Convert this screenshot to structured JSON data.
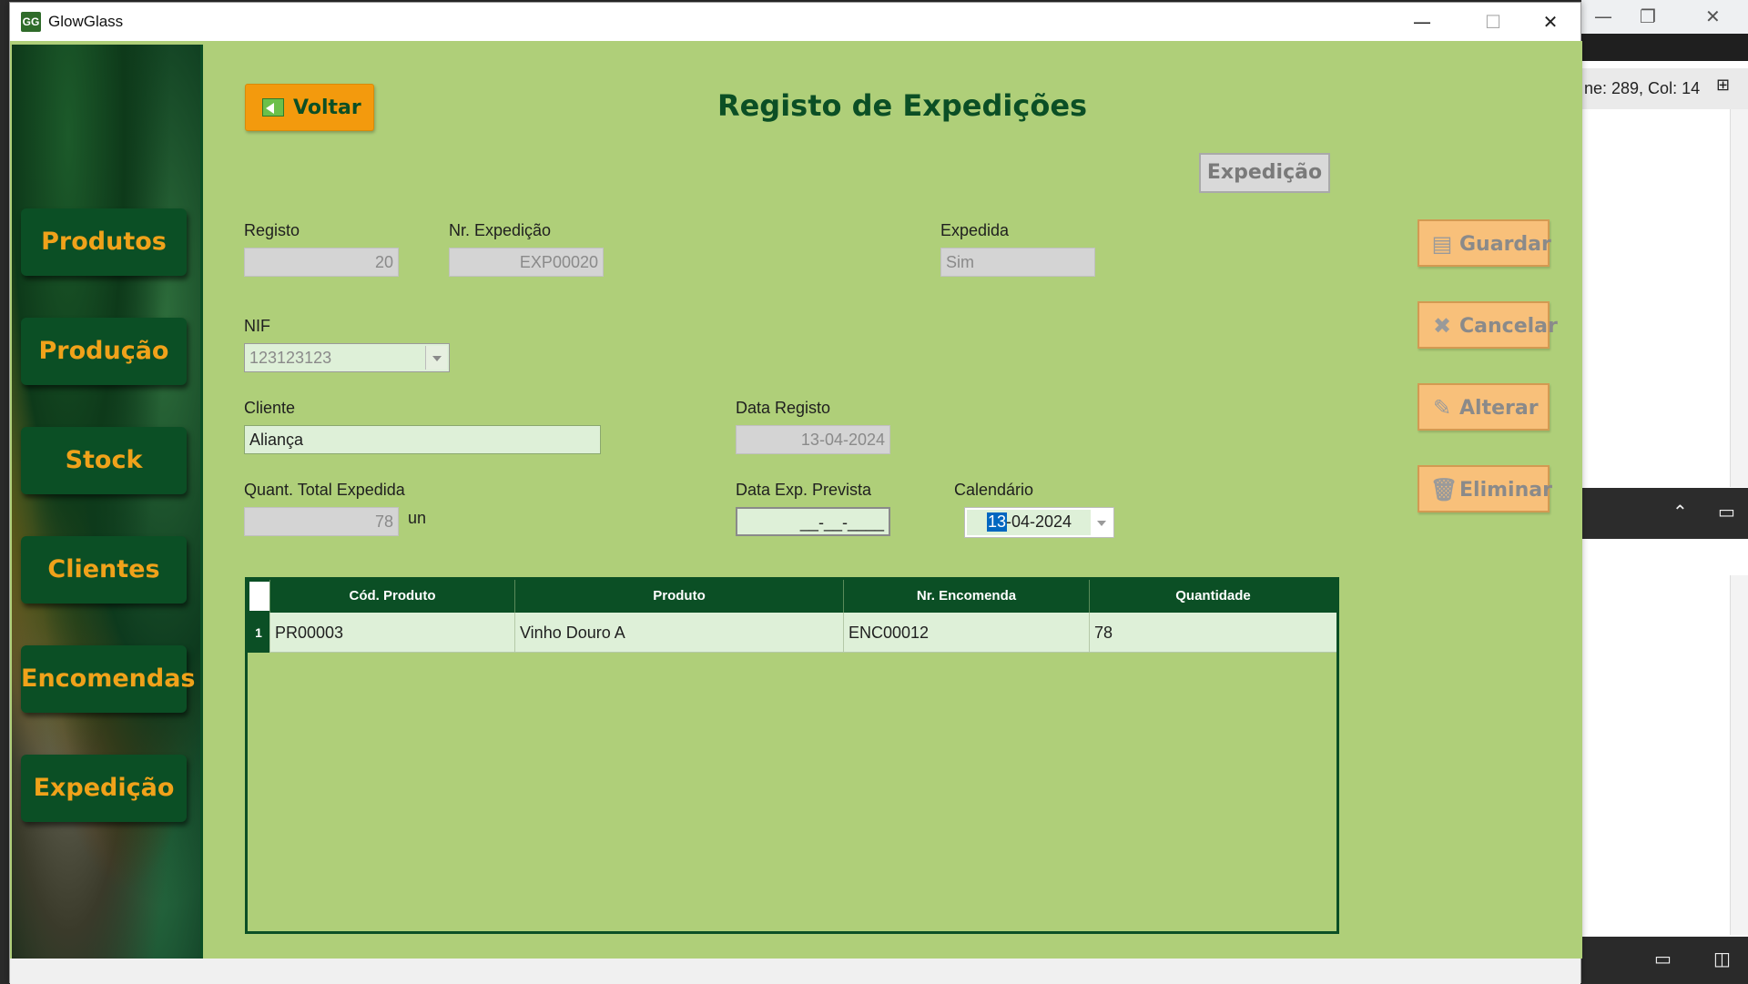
{
  "background_app": {
    "status_text": "ne: 289, Col: 14"
  },
  "window": {
    "icon_text": "GG",
    "title": "GlowGlass",
    "minimize": "—",
    "maximize": "☐",
    "close": "✕"
  },
  "sidebar": {
    "items": [
      {
        "label": "Produtos"
      },
      {
        "label": "Produção"
      },
      {
        "label": "Stock"
      },
      {
        "label": "Clientes"
      },
      {
        "label": "Encomendas"
      },
      {
        "label": "Expedição"
      }
    ]
  },
  "header": {
    "back_label": "Voltar",
    "title": "Registo de Expedições",
    "expedicao_button": "Expedição"
  },
  "form": {
    "registo_label": "Registo",
    "registo_value": "20",
    "nr_expedicao_label": "Nr. Expedição",
    "nr_expedicao_value": "EXP00020",
    "expedida_label": "Expedida",
    "expedida_value": "Sim",
    "nif_label": "NIF",
    "nif_value": "123123123",
    "cliente_label": "Cliente",
    "cliente_value": "Aliança",
    "data_registo_label": "Data Registo",
    "data_registo_value": "13-04-2024",
    "quant_label": "Quant. Total Expedida",
    "quant_value": "78",
    "quant_unit": "un",
    "data_exp_label": "Data Exp. Prevista",
    "data_exp_value": "__-__-____",
    "calendario_label": "Calendário",
    "calendario_day": "13",
    "calendario_rest": "-04-2024"
  },
  "actions": {
    "guardar": "Guardar",
    "cancelar": "Cancelar",
    "alterar": "Alterar",
    "eliminar": "Eliminar"
  },
  "table": {
    "columns": [
      "Cód. Produto",
      "Produto",
      "Nr. Encomenda",
      "Quantidade"
    ],
    "rows": [
      {
        "index": "1",
        "cod": "PR00003",
        "produto": "Vinho Douro A",
        "encomenda": "ENC00012",
        "quantidade": "78"
      }
    ]
  },
  "colors": {
    "content_bg": "#afcf79",
    "dark_green": "#0b4f25",
    "orange": "#f39a0d",
    "light_orange": "#f8c07a",
    "field_green": "#def0d8"
  }
}
